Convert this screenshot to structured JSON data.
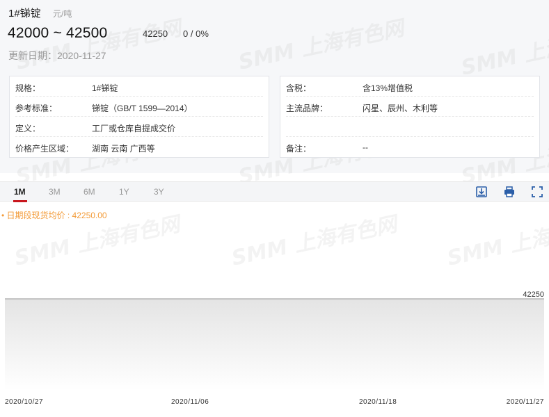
{
  "product": {
    "title": "1#锑锭",
    "unit": "元/吨"
  },
  "price": {
    "range_low": "42000",
    "range_sep": "~",
    "range_high": "42500",
    "average": "42250",
    "change": "0",
    "change_sep": "/",
    "change_pct": "0%",
    "updated": "更新日期：2020-11-27"
  },
  "watermark": "SMM 上海有色网",
  "specs_left": [
    {
      "key": "规格：",
      "value": "1#锑锭"
    },
    {
      "key": "参考标准：",
      "value": "锑锭（GB/T 1599—2014）"
    },
    {
      "key": "定义：",
      "value": "工厂或仓库自提成交价"
    },
    {
      "key": "价格产生区域：",
      "value": "湖南 云南 广西等"
    }
  ],
  "specs_right": [
    {
      "key": "含税：",
      "value": "含13%增值税"
    },
    {
      "key": "主流品牌：",
      "value": "闪星、辰州、木利等"
    },
    {
      "key": "",
      "value": ""
    },
    {
      "key": "备注：",
      "value": "--"
    }
  ],
  "tabs": [
    "1M",
    "3M",
    "6M",
    "1Y",
    "3Y"
  ],
  "active_tab": "1M",
  "toolbar_icons": [
    "download-image-icon",
    "print-icon",
    "fullscreen-icon"
  ],
  "colors": {
    "accent": "#c8161d",
    "legend": "#f39c3a",
    "area_top": "#e6e6e6",
    "area_bottom": "#ffffff"
  },
  "chart_data": {
    "type": "area",
    "legend": "日期段现货均价 : 42250.00",
    "x": [
      "2020/10/27",
      "2020/11/06",
      "2020/11/18",
      "2020/11/27"
    ],
    "x_labels": [
      "2020/10/27",
      "2020/11/06",
      "2020/11/18",
      "2020/11/27"
    ],
    "values": [
      42250,
      42250,
      42250,
      42250
    ],
    "y_tick_labels": [
      "42250"
    ],
    "grid": false
  }
}
